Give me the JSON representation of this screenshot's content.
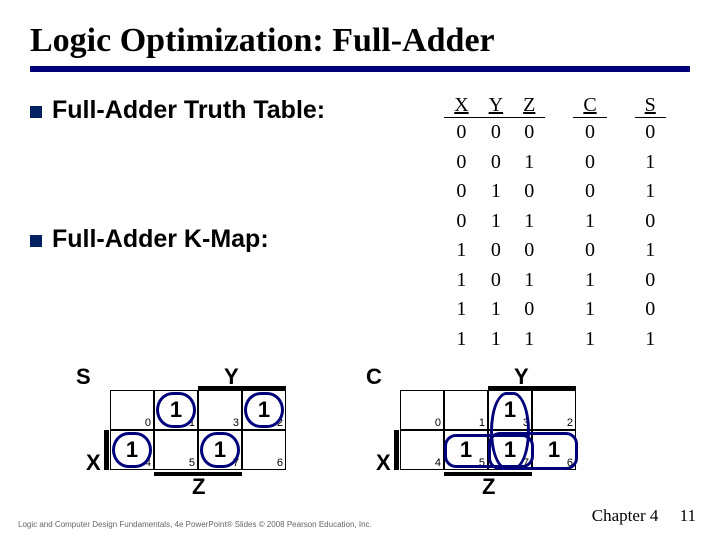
{
  "title": "Logic Optimization: Full-Adder",
  "bullets": [
    "Full-Adder Truth Table:",
    "Full-Adder K-Map:"
  ],
  "truth_table": {
    "headers": [
      "X",
      "Y",
      "Z",
      "C",
      "S"
    ],
    "rows": [
      [
        "0",
        "0",
        "0",
        "0",
        "0"
      ],
      [
        "0",
        "0",
        "1",
        "0",
        "1"
      ],
      [
        "0",
        "1",
        "0",
        "0",
        "1"
      ],
      [
        "0",
        "1",
        "1",
        "1",
        "0"
      ],
      [
        "1",
        "0",
        "0",
        "0",
        "1"
      ],
      [
        "1",
        "0",
        "1",
        "1",
        "0"
      ],
      [
        "1",
        "1",
        "0",
        "1",
        "0"
      ],
      [
        "1",
        "1",
        "1",
        "1",
        "1"
      ]
    ]
  },
  "kmaps": {
    "s": {
      "label": "S",
      "cells": [
        {
          "idx": "0",
          "val": ""
        },
        {
          "idx": "1",
          "val": "1"
        },
        {
          "idx": "3",
          "val": ""
        },
        {
          "idx": "2",
          "val": "1"
        },
        {
          "idx": "4",
          "val": "1"
        },
        {
          "idx": "5",
          "val": ""
        },
        {
          "idx": "7",
          "val": "1"
        },
        {
          "idx": "6",
          "val": ""
        }
      ],
      "axis": {
        "x": "X",
        "y": "Y",
        "z": "Z"
      }
    },
    "c": {
      "label": "C",
      "cells": [
        {
          "idx": "0",
          "val": ""
        },
        {
          "idx": "1",
          "val": ""
        },
        {
          "idx": "3",
          "val": "1"
        },
        {
          "idx": "2",
          "val": ""
        },
        {
          "idx": "4",
          "val": ""
        },
        {
          "idx": "5",
          "val": "1"
        },
        {
          "idx": "7",
          "val": "1"
        },
        {
          "idx": "6",
          "val": "1"
        }
      ],
      "axis": {
        "x": "X",
        "y": "Y",
        "z": "Z"
      }
    }
  },
  "footer_left": "Logic and Computer Design Fundamentals, 4e\nPowerPoint® Slides\n© 2008 Pearson Education, Inc.",
  "footer_chapter": "Chapter 4",
  "footer_page": "11",
  "chart_data": {
    "type": "table",
    "title": "Full-Adder Truth Table",
    "columns": [
      "X",
      "Y",
      "Z",
      "C",
      "S"
    ],
    "rows": [
      [
        0,
        0,
        0,
        0,
        0
      ],
      [
        0,
        0,
        1,
        0,
        1
      ],
      [
        0,
        1,
        0,
        0,
        1
      ],
      [
        0,
        1,
        1,
        1,
        0
      ],
      [
        1,
        0,
        0,
        0,
        1
      ],
      [
        1,
        0,
        1,
        1,
        0
      ],
      [
        1,
        1,
        0,
        1,
        0
      ],
      [
        1,
        1,
        1,
        1,
        1
      ]
    ]
  }
}
